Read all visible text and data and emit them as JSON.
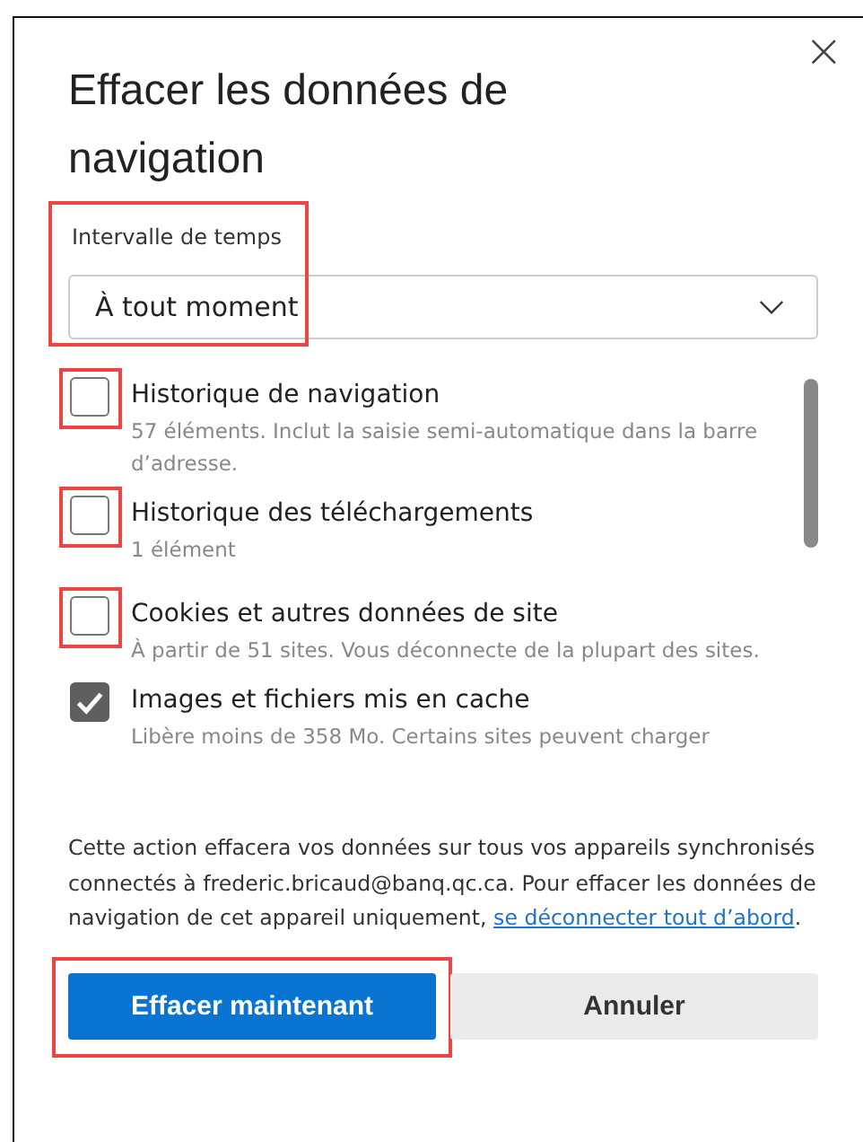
{
  "dialog": {
    "title": "Effacer les données de navigation",
    "close": "×"
  },
  "time_range": {
    "label": "Intervalle de temps",
    "value": "À tout moment",
    "highlighted": true
  },
  "items": [
    {
      "title": "Historique de navigation",
      "description": "57 éléments. Inclut la saisie semi-automatique dans la barre d’adresse.",
      "checked": false,
      "highlighted": true
    },
    {
      "title": "Historique des téléchargements",
      "description": "1 élément",
      "checked": false,
      "highlighted": true
    },
    {
      "title": "Cookies et autres données de site",
      "description": "À partir de 51 sites. Vous déconnecte de la plupart des sites.",
      "checked": false,
      "highlighted": true
    },
    {
      "title": "Images et fichiers mis en cache",
      "description": "Libère moins de 358 Mo. Certains sites peuvent charger",
      "checked": true,
      "highlighted": false
    }
  ],
  "notice": {
    "text": "Cette action effacera vos données sur tous vos appareils synchronisés connectés à frederic.bricaud@banq.qc.ca. Pour effacer les données de navigation de cet appareil uniquement,",
    "link": "se déconnecter tout d’abord",
    "end": "."
  },
  "buttons": [
    {
      "label": "Effacer maintenant",
      "kind": "primary",
      "highlighted": true
    },
    {
      "label": "Annuler",
      "kind": "secondary",
      "highlighted": false
    }
  ]
}
